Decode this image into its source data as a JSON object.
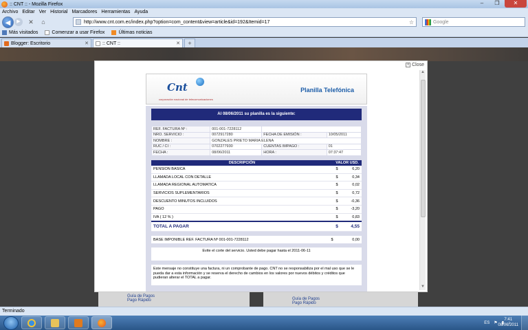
{
  "window": {
    "title": ":: CNT :: - Mozilla Firefox",
    "minimize": "–",
    "maximize": "❐",
    "close": "✕"
  },
  "menu": [
    "Archivo",
    "Editar",
    "Ver",
    "Historial",
    "Marcadores",
    "Herramientas",
    "Ayuda"
  ],
  "nav": {
    "url": "http://www.cnt.com.ec/index.php?option=com_content&view=article&id=192&Itemid=17",
    "search_placeholder": "Google",
    "back_glyph": "◀",
    "forward_glyph": "▶",
    "stop_glyph": "✕",
    "home_glyph": "⌂",
    "star_glyph": "☆"
  },
  "bookmarks": [
    "Más visitados",
    "Comenzar a usar Firefox",
    "Últimas noticias"
  ],
  "tabs": [
    {
      "label": "Blogger: Escritorio",
      "active": false
    },
    {
      "label": ":: CNT ::",
      "active": true
    }
  ],
  "lightbox": {
    "close_label": "Close",
    "header": {
      "logo": "Cnt",
      "logo_sub": "corporación nacional de telecomunicaciones",
      "title": "Planilla Telefónica"
    },
    "banner": "Al 08/06/2011 su planilla es la siguiente:",
    "info": {
      "ref_label": "REF. FACTURA Nº :",
      "ref_value": "001-001-7228112",
      "service_label": "NRO. SERVICIO :",
      "service_value": "0072917280",
      "emission_label": "FECHA DE EMISIÓN :",
      "emission_value": "10/05/2011",
      "name_label": "NOMBRE :",
      "name_value": "GONZALES PRIETO MARIA ELENA",
      "ruc_label": "RUC / CI :",
      "ruc_value": "0702277930",
      "unpaid_label": "CUENTAS IMPAGO :",
      "unpaid_value": "01",
      "date_label": "FECHA :",
      "date_value": "08/06/2011",
      "time_label": "HORA :",
      "time_value": "07:37:47"
    },
    "detail": {
      "col_desc": "DESCRIPCIÓN",
      "col_value": "VALOR USD.",
      "rows": [
        {
          "desc": "PENSION BASICA",
          "cur": "$",
          "val": "6,20"
        },
        {
          "desc": "LLAMADA LOCAL CON DETALLE",
          "cur": "$",
          "val": "0,34"
        },
        {
          "desc": "LLAMADA REGIONAL AUTOMATICA",
          "cur": "$",
          "val": "0,02"
        },
        {
          "desc": "SERVICIOS SUPLEMENTARIOS",
          "cur": "$",
          "val": "0,72"
        },
        {
          "desc": "DESCUENTO MINUTOS INCLUIDOS",
          "cur": "$",
          "val": "-0,36"
        },
        {
          "desc": "PAGO",
          "cur": "$",
          "val": "-3,20"
        },
        {
          "desc": "IVA ( 12 % )",
          "cur": "$",
          "val": "0,83"
        }
      ],
      "total_label": "TOTAL A PAGAR",
      "total_cur": "$",
      "total_value": "4,55"
    },
    "base": {
      "label": "BASE IMPONIBLE REF. FACTURA Nº 001-001-7228112",
      "cur": "$",
      "value": "0,00"
    },
    "notice": "Evite el corte del servicio. Usted debe pagar hasta el 2011-06-11",
    "disclaimer": "Este mensaje no constituye una factura, ni un comprobante de pago. CNT no se responsabiliza por el mal uso que se le pueda dar a esta información y se reserva el derecho de cambios en los valores por nuevos débitos y créditos que pudieran alterar el TOTAL a pagar."
  },
  "background": {
    "links_left": [
      "Guía de Pagos",
      "Pago Rápido"
    ],
    "links_right": [
      "Guía de Pagos",
      "Pago Rápido"
    ]
  },
  "status": "Terminado",
  "taskbar": {
    "lang": "ES",
    "time": "7:41",
    "date": "08/06/2011"
  }
}
